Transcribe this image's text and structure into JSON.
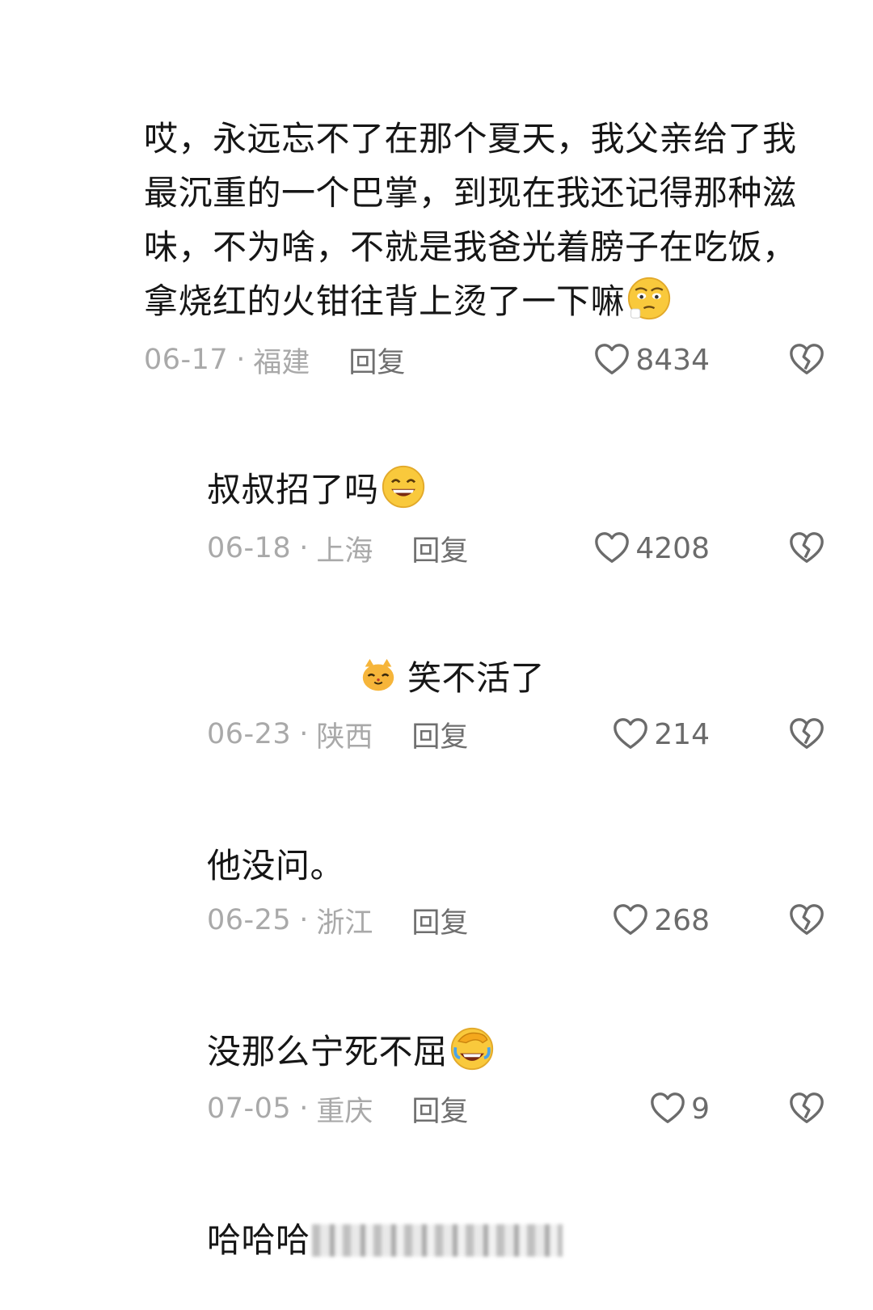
{
  "comments": [
    {
      "text": "哎，永远忘不了在那个夏天，我父亲给了我最沉重的一个巴掌，到现在我还记得那种滋味，不为啥，不就是我爸光着膀子在吃饭，拿烧红的火钳往背上烫了一下嘛",
      "emoji": "pleading-face-emoji",
      "date": "06-17",
      "location": "福建",
      "reply_label": "回复",
      "likes": "8434"
    },
    {
      "text": "叔叔招了吗",
      "emoji": "grinning-face-emoji",
      "date": "06-18",
      "location": "上海",
      "reply_label": "回复",
      "likes": "4208"
    },
    {
      "text": "笑不活了",
      "emoji": "cat-face-emoji",
      "date": "06-23",
      "location": "陕西",
      "reply_label": "回复",
      "likes": "214"
    },
    {
      "text": "他没问。",
      "date": "06-25",
      "location": "浙江",
      "reply_label": "回复",
      "likes": "268"
    },
    {
      "text": "没那么宁死不屈",
      "emoji": "face-palm-laugh-emoji",
      "date": "07-05",
      "location": "重庆",
      "reply_label": "回复",
      "likes": "9"
    },
    {
      "text": "哈哈哈"
    }
  ],
  "separator": "·",
  "colors": {
    "text": "#161616",
    "meta": "#a9a9a9",
    "reply": "#6f6f6f",
    "icon": "#6b6b6b"
  }
}
